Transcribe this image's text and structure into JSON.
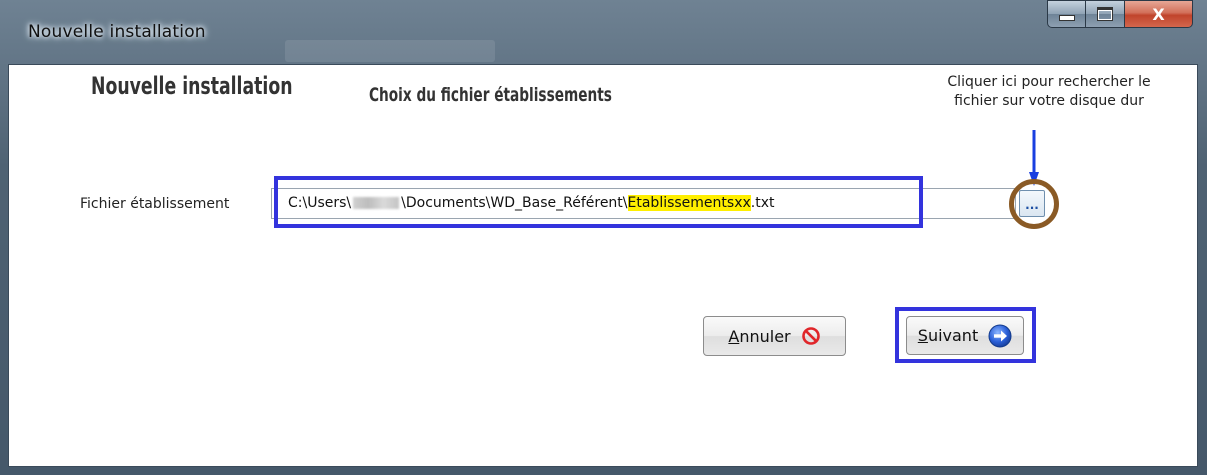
{
  "window": {
    "title": "Nouvelle installation",
    "controls": {
      "minimize_icon": "minimize-icon",
      "maximize_icon": "maximize-icon",
      "close_label": "X"
    }
  },
  "content": {
    "heading": "Nouvelle installation",
    "subheading": "Choix du fichier établissements",
    "hint_line1": "Cliquer ici pour rechercher le",
    "hint_line2": "fichier sur votre disque dur",
    "field_label": "Fichier établissement",
    "path_before": "C:\\Users\\",
    "path_middle": "\\Documents\\WD_Base_Référent\\",
    "path_highlighted": "Etablissementsxx",
    "path_after": ".txt",
    "browse_label": "..."
  },
  "buttons": {
    "cancel": {
      "mnemonic": "A",
      "rest": "nnuler",
      "icon": "no-entry-icon"
    },
    "next": {
      "mnemonic": "S",
      "rest": "uivant",
      "icon": "arrow-right-circle-icon"
    }
  },
  "colors": {
    "highlight_box": "#3333dd",
    "browse_circle": "#8a5a25",
    "arrow": "#1a3fe0",
    "text_highlight": "#ffef00",
    "cancel_icon": "#e0262a",
    "next_icon": "#2a5fd8"
  }
}
